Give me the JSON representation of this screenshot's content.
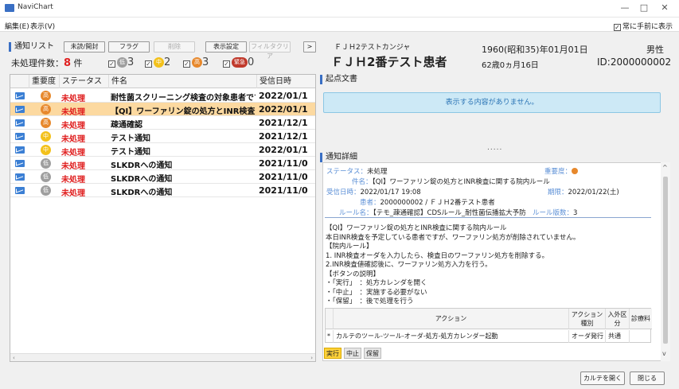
{
  "window": {
    "title": "NaviChart",
    "minimize": "—",
    "maximize": "□",
    "close": "✕"
  },
  "menu": {
    "items": [
      "編集(E)",
      "表示(V)"
    ],
    "bring_front_label": "常に手前に表示",
    "bring_front_checked": true
  },
  "left": {
    "section_title": "通知リスト",
    "toolbar": {
      "unread_read": "未読/開封",
      "flag": "フラグ",
      "delete": "削除",
      "display_settings": "表示設定",
      "filter_clear": "フィルタクリア",
      "next": ">"
    },
    "pending_label": "未処理件数：",
    "pending_count": "8",
    "pending_unit": "件",
    "filters": [
      {
        "label": "低",
        "count": "3",
        "color": "#9e9e9e",
        "checked": true
      },
      {
        "label": "中",
        "count": "2",
        "color": "#f3c11b",
        "checked": true
      },
      {
        "label": "高",
        "count": "3",
        "color": "#e7882c",
        "checked": true
      },
      {
        "label": "緊急",
        "count": "0",
        "color": "#c0392b",
        "checked": true
      }
    ],
    "columns": [
      "重要度",
      "ステータス",
      "件名",
      "受信日時"
    ],
    "rows": [
      {
        "priority": "高",
        "pcolor": "#e7882c",
        "status": "未処理",
        "subject": "耐性菌スクリーニング検査の対象患者です",
        "received": "2022/01/1",
        "selected": false
      },
      {
        "priority": "高",
        "pcolor": "#e7882c",
        "status": "未処理",
        "subject": "【QI】ワーファリン錠の処方とINR検査に関",
        "received": "2022/01/1",
        "selected": true
      },
      {
        "priority": "高",
        "pcolor": "#e7882c",
        "status": "未処理",
        "subject": "疎通確認",
        "received": "2021/12/1",
        "selected": false
      },
      {
        "priority": "中",
        "pcolor": "#f3c11b",
        "status": "未処理",
        "subject": "テスト通知",
        "received": "2021/12/1",
        "selected": false
      },
      {
        "priority": "中",
        "pcolor": "#f3c11b",
        "status": "未処理",
        "subject": "テスト通知",
        "received": "2022/01/1",
        "selected": false
      },
      {
        "priority": "低",
        "pcolor": "#9e9e9e",
        "status": "未処理",
        "subject": "SLKDRへの通知",
        "received": "2021/11/0",
        "selected": false
      },
      {
        "priority": "低",
        "pcolor": "#9e9e9e",
        "status": "未処理",
        "subject": "SLKDRへの通知",
        "received": "2021/11/0",
        "selected": false
      },
      {
        "priority": "低",
        "pcolor": "#9e9e9e",
        "status": "未処理",
        "subject": "SLKDRへの通知",
        "received": "2021/11/0",
        "selected": false
      }
    ]
  },
  "patient": {
    "kana": "ＦＪＨ2テストカンジャ",
    "name": "ＦＪＨ2番テスト患者",
    "birthdate": "1960(昭和35)年01月01日",
    "age": "62歳0ヵ月16日",
    "sex": "男性",
    "id": "ID:2000000002"
  },
  "origin_doc": {
    "title": "起点文書",
    "empty_message": "表示する内容がありません。",
    "splitter": "....."
  },
  "detail": {
    "title": "通知詳細",
    "status_label": "ステータス：",
    "status": "未処理",
    "importance_label": "重要度：",
    "subject_label": "件名：",
    "subject": "【QI】ワーファリン錠の処方とINR検査に関する院内ルール",
    "received_label": "受信日時：",
    "received": "2022/01/17 19:08",
    "deadline_label": "期限：",
    "deadline": "2022/01/22(土)",
    "patient_label": "患者：",
    "patient": "2000000002 / ＦＪＨ2番テスト患者",
    "rule_label": "ルール名：",
    "rule": "【テモ_疎通確認】CDSルール_耐性菌伝播拡大予防",
    "rule_ver_label": "ルール版数：",
    "rule_ver": "3",
    "body": [
      "【QI】ワーファリン錠の処方とINR検査に関する院内ルール",
      "本日INR検査を予定している患者ですが、ワーファリン処方が削除されていません。",
      "【院内ルール】",
      "1. INR検査オーダを入力したら、検査日のワーファリン処方を削除する。",
      "2.INR検査値確認後に、ワーファリン処方入力を行う。",
      "【ボタンの説明】",
      "・「実行」　：処方カレンダを開く",
      "・「中止」　：実施する必要がない",
      "・「保留」　：後で処理を行う"
    ],
    "action_cols": [
      "アクション",
      "アクション種別",
      "入外区分",
      "診療料"
    ],
    "action_row": {
      "marker": "*",
      "action": "カルテのツール-ツール-オーダ-処方-処方カレンダー起動",
      "type": "オーダ発行",
      "inout": "共通",
      "fee": ""
    },
    "buttons": {
      "execute": "実行",
      "stop": "中止",
      "hold": "保留"
    }
  },
  "footer": {
    "open_chart": "カルテを開く",
    "close": "閉じる"
  }
}
